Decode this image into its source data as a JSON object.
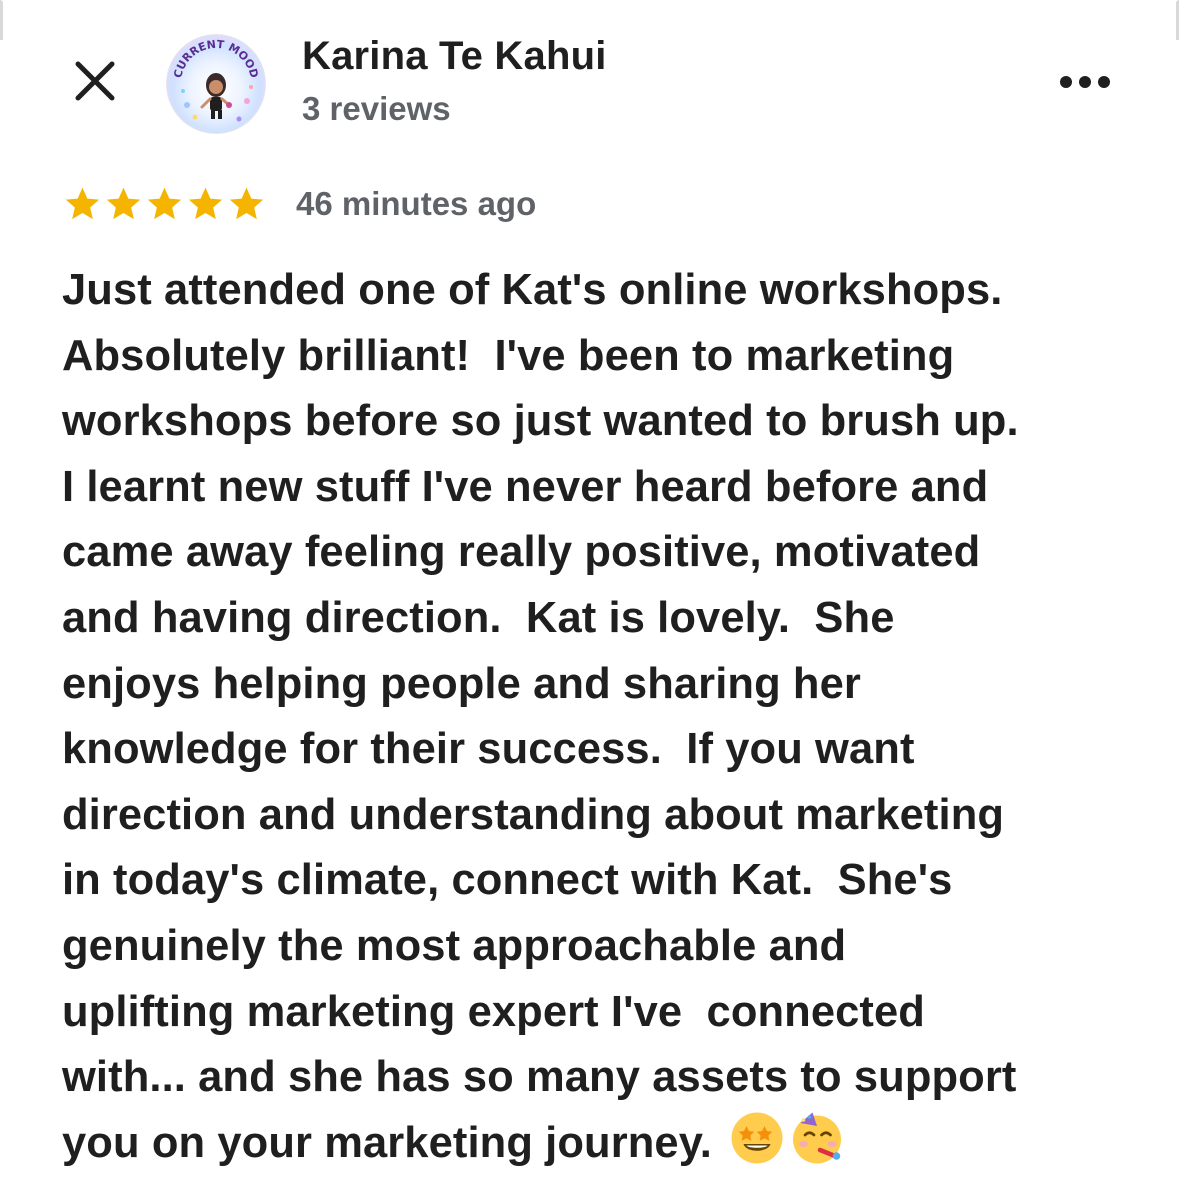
{
  "header": {
    "close_icon": "close-icon",
    "author_name": "Karina Te Kahui",
    "author_meta": "3 reviews",
    "avatar_caption": "CURRENT MOOD",
    "more_icon": "more-horizontal-icon"
  },
  "review": {
    "rating": 5,
    "rating_max": 5,
    "star_color": "#F4B400",
    "timestamp": "46 minutes ago",
    "lines": [
      "Just attended one of Kat's online workshops.",
      "Absolutely brilliant!  I've been to marketing",
      "workshops before so just wanted to brush up.",
      "I learnt new stuff I've never heard before and",
      "came away feeling really positive, motivated",
      "and having direction.  Kat is lovely.  She",
      "enjoys helping people and sharing her",
      "knowledge for their success.  If you want",
      "direction and understanding about marketing",
      "in today's climate, connect with Kat.  She's",
      "genuinely the most approachable and",
      "uplifting marketing expert I've  connected",
      "with... and she has so many assets to support",
      "you on your marketing journey. "
    ],
    "emojis": [
      "star-struck-emoji",
      "partying-face-emoji"
    ]
  }
}
